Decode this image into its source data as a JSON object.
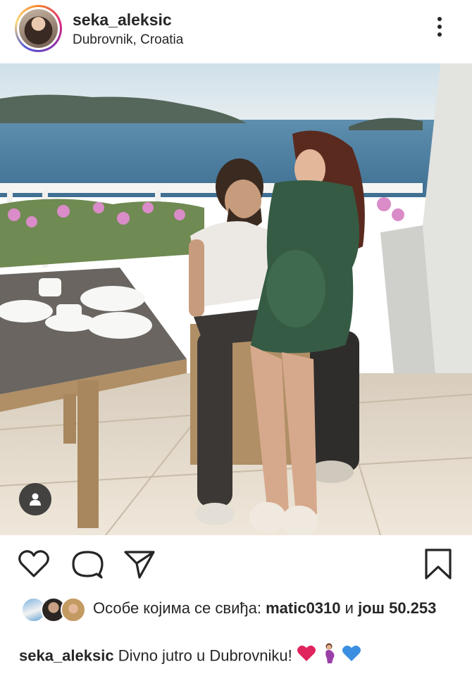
{
  "post": {
    "username": "seka_aleksic",
    "location": "Dubrovnik, Croatia",
    "icons": {
      "more": "more-vertical-icon",
      "tag": "user-tag-icon",
      "like": "heart-outline-icon",
      "comment": "comment-icon",
      "share": "send-icon",
      "save": "bookmark-icon"
    }
  },
  "likes": {
    "prefix": "Особе којима се свиђа:",
    "top_liker": "matic0310",
    "connector": "и",
    "others_label": "још",
    "count": "50.253"
  },
  "caption": {
    "username": "seka_aleksic",
    "text": "Divno jutro u Dubrovniku!",
    "emojis": [
      "red-heart-emoji",
      "pregnant-woman-emoji",
      "blue-heart-emoji"
    ]
  },
  "colors": {
    "text": "#262626",
    "heart_red": "#e0245e",
    "heart_blue": "#3b8fe0"
  }
}
